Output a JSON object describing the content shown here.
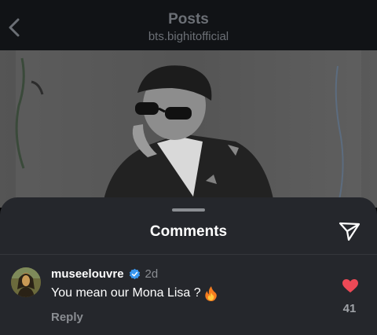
{
  "header": {
    "title": "Posts",
    "subtitle": "bts.bighitofficial"
  },
  "comments_sheet": {
    "title": "Comments"
  },
  "comment": {
    "username": "museelouvre",
    "age": "2d",
    "text": "You mean our Mona Lisa ?",
    "reply_label": "Reply",
    "like_count": "41"
  },
  "colors": {
    "topbar": "#111316",
    "sheet": "#25272c",
    "verified": "#3897f0",
    "heart": "#ed4956"
  }
}
